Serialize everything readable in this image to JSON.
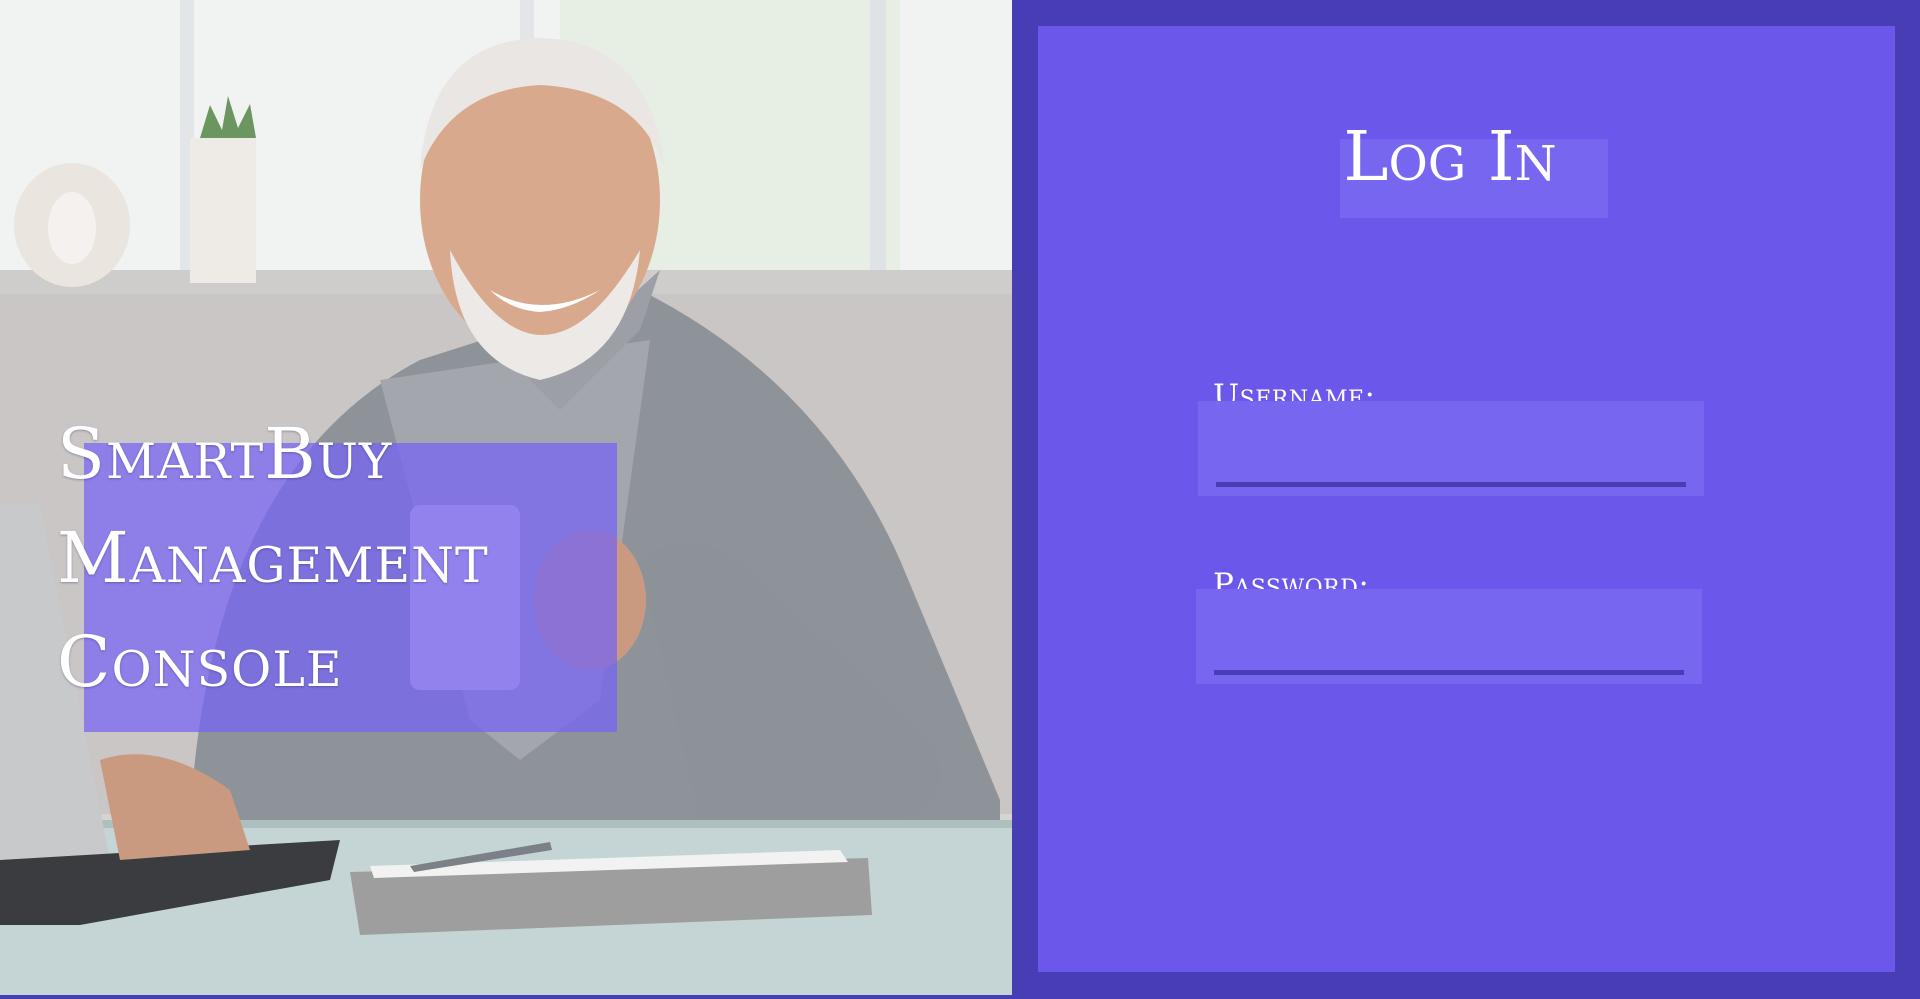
{
  "hero": {
    "title_lines": [
      "SmartBuy",
      "Management",
      "Console"
    ],
    "image_subject": "man-at-desk-with-laptop-and-mug"
  },
  "login": {
    "heading": "Log In",
    "username_label": "Username:",
    "username_value": "",
    "password_label": "Password:",
    "password_value": ""
  },
  "colors": {
    "frame": "#473db5",
    "panel": "#6b58ea",
    "field_bg": "#7767f0",
    "accent_overlay": "#7662f5",
    "text": "#ffffff"
  }
}
